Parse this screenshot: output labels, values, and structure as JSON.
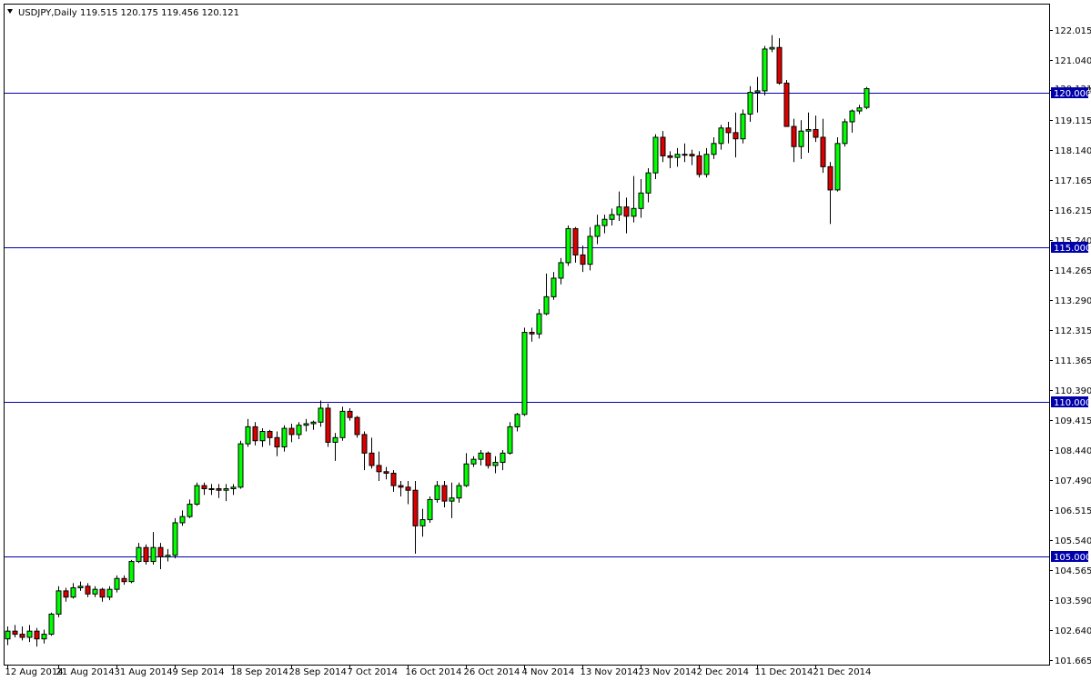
{
  "header": {
    "symbol": "USDJPY,Daily",
    "ohlc": "119.515 120.175 119.456 120.121"
  },
  "colors": {
    "background": "#ffffff",
    "frame": "#000000",
    "bull": "#00ff00",
    "bear": "#dd0000",
    "wick": "#000000",
    "level_line": "#0000aa",
    "level_label_bg": "#0000aa",
    "level_label_text": "#ffffff"
  },
  "chart_data": {
    "type": "candlestick",
    "title": "USDJPY,Daily",
    "ylim": [
      101.665,
      122.015
    ],
    "price_ticks": [
      "122.015",
      "121.040",
      "120.090",
      "119.115",
      "118.140",
      "117.165",
      "116.215",
      "115.240",
      "114.265",
      "113.290",
      "112.315",
      "111.365",
      "110.390",
      "109.415",
      "108.440",
      "107.490",
      "106.515",
      "105.540",
      "104.565",
      "103.590",
      "102.640",
      "101.665"
    ],
    "date_ticks": [
      "12 Aug 2014",
      "21 Aug 2014",
      "31 Aug 2014",
      "9 Sep 2014",
      "18 Sep 2014",
      "28 Sep 2014",
      "7 Oct 2014",
      "16 Oct 2014",
      "26 Oct 2014",
      "4 Nov 2014",
      "13 Nov 2014",
      "23 Nov 2014",
      "2 Dec 2014",
      "11 Dec 2014",
      "21 Dec 2014"
    ],
    "date_tick_bar_index": [
      0,
      7,
      15,
      23,
      31,
      39,
      47,
      55,
      63,
      71,
      79,
      87,
      95,
      103,
      111
    ],
    "levels": [
      {
        "value": 120.0,
        "label": "120.000"
      },
      {
        "value": 115.0,
        "label": "115.000"
      },
      {
        "value": 110.0,
        "label": "110.000"
      },
      {
        "value": 105.0,
        "label": "105.000"
      }
    ],
    "current_price": {
      "value": 120.121,
      "label": "120.121"
    },
    "grid": false,
    "candles": [
      [
        102.35,
        102.75,
        102.15,
        102.6
      ],
      [
        102.6,
        102.8,
        102.4,
        102.5
      ],
      [
        102.5,
        102.75,
        102.3,
        102.4
      ],
      [
        102.4,
        102.8,
        102.25,
        102.6
      ],
      [
        102.6,
        102.7,
        102.1,
        102.35
      ],
      [
        102.35,
        102.65,
        102.2,
        102.5
      ],
      [
        102.5,
        103.2,
        102.45,
        103.15
      ],
      [
        103.15,
        104.05,
        103.05,
        103.9
      ],
      [
        103.9,
        104.0,
        103.55,
        103.7
      ],
      [
        103.7,
        104.15,
        103.65,
        104.0
      ],
      [
        104.0,
        104.2,
        103.9,
        104.05
      ],
      [
        104.05,
        104.15,
        103.7,
        103.8
      ],
      [
        103.8,
        104.05,
        103.7,
        103.95
      ],
      [
        103.95,
        104.0,
        103.55,
        103.7
      ],
      [
        103.7,
        104.05,
        103.6,
        103.95
      ],
      [
        103.95,
        104.4,
        103.85,
        104.3
      ],
      [
        104.3,
        104.4,
        104.1,
        104.2
      ],
      [
        104.2,
        104.9,
        104.15,
        104.85
      ],
      [
        104.85,
        105.45,
        104.8,
        105.3
      ],
      [
        105.3,
        105.4,
        104.75,
        104.85
      ],
      [
        104.85,
        105.8,
        104.75,
        105.3
      ],
      [
        105.3,
        105.45,
        104.6,
        105.0
      ],
      [
        105.0,
        105.25,
        104.85,
        105.05
      ],
      [
        105.05,
        106.25,
        104.95,
        106.1
      ],
      [
        106.1,
        106.5,
        106.0,
        106.3
      ],
      [
        106.3,
        106.85,
        106.25,
        106.7
      ],
      [
        106.7,
        107.4,
        106.65,
        107.3
      ],
      [
        107.3,
        107.4,
        107.0,
        107.2
      ],
      [
        107.2,
        107.35,
        107.0,
        107.2
      ],
      [
        107.2,
        107.35,
        106.9,
        107.15
      ],
      [
        107.15,
        107.35,
        106.8,
        107.2
      ],
      [
        107.2,
        107.35,
        107.0,
        107.25
      ],
      [
        107.25,
        108.75,
        107.2,
        108.65
      ],
      [
        108.65,
        109.45,
        108.55,
        109.2
      ],
      [
        109.2,
        109.35,
        108.6,
        108.75
      ],
      [
        108.75,
        109.15,
        108.55,
        109.05
      ],
      [
        109.05,
        109.1,
        108.6,
        108.85
      ],
      [
        108.85,
        109.05,
        108.25,
        108.55
      ],
      [
        108.55,
        109.25,
        108.4,
        109.15
      ],
      [
        109.15,
        109.3,
        108.7,
        108.95
      ],
      [
        108.95,
        109.35,
        108.8,
        109.25
      ],
      [
        109.25,
        109.45,
        109.05,
        109.3
      ],
      [
        109.3,
        109.4,
        109.1,
        109.35
      ],
      [
        109.35,
        110.05,
        109.2,
        109.8
      ],
      [
        109.8,
        109.95,
        108.55,
        108.7
      ],
      [
        108.7,
        109.0,
        108.1,
        108.85
      ],
      [
        108.85,
        109.85,
        108.75,
        109.7
      ],
      [
        109.7,
        109.8,
        109.4,
        109.5
      ],
      [
        109.5,
        109.55,
        108.85,
        108.95
      ],
      [
        108.95,
        109.05,
        107.8,
        108.35
      ],
      [
        108.35,
        108.85,
        107.85,
        107.95
      ],
      [
        107.95,
        108.4,
        107.45,
        107.75
      ],
      [
        107.75,
        107.9,
        107.5,
        107.7
      ],
      [
        107.7,
        107.8,
        107.1,
        107.3
      ],
      [
        107.3,
        107.45,
        106.95,
        107.25
      ],
      [
        107.25,
        107.45,
        106.7,
        107.15
      ],
      [
        107.15,
        107.45,
        105.1,
        106.0
      ],
      [
        106.0,
        106.55,
        105.65,
        106.2
      ],
      [
        106.2,
        106.95,
        106.1,
        106.85
      ],
      [
        106.85,
        107.45,
        106.75,
        107.3
      ],
      [
        107.3,
        107.45,
        106.6,
        106.8
      ],
      [
        106.8,
        107.4,
        106.25,
        106.9
      ],
      [
        106.9,
        107.4,
        106.75,
        107.3
      ],
      [
        107.3,
        108.35,
        107.25,
        108.0
      ],
      [
        108.0,
        108.25,
        107.9,
        108.15
      ],
      [
        108.15,
        108.45,
        107.95,
        108.35
      ],
      [
        108.35,
        108.4,
        107.85,
        107.95
      ],
      [
        107.95,
        108.25,
        107.7,
        108.05
      ],
      [
        108.05,
        108.45,
        107.8,
        108.35
      ],
      [
        108.35,
        109.35,
        108.3,
        109.2
      ],
      [
        109.2,
        109.65,
        109.05,
        109.6
      ],
      [
        109.6,
        112.4,
        109.55,
        112.25
      ],
      [
        112.25,
        112.4,
        111.95,
        112.2
      ],
      [
        112.2,
        113.0,
        112.05,
        112.85
      ],
      [
        112.85,
        114.15,
        112.8,
        113.4
      ],
      [
        113.4,
        114.2,
        113.3,
        114.0
      ],
      [
        114.0,
        114.65,
        113.8,
        114.5
      ],
      [
        114.5,
        115.7,
        114.4,
        115.6
      ],
      [
        115.6,
        115.65,
        114.5,
        114.75
      ],
      [
        114.75,
        115.05,
        114.2,
        114.45
      ],
      [
        114.45,
        115.65,
        114.25,
        115.35
      ],
      [
        115.35,
        116.05,
        115.1,
        115.7
      ],
      [
        115.7,
        116.05,
        115.45,
        115.9
      ],
      [
        115.9,
        116.25,
        115.7,
        116.05
      ],
      [
        116.05,
        116.8,
        115.85,
        116.3
      ],
      [
        116.3,
        116.6,
        115.45,
        116.0
      ],
      [
        116.0,
        117.3,
        115.8,
        116.25
      ],
      [
        116.25,
        117.2,
        115.95,
        116.75
      ],
      [
        116.75,
        117.55,
        116.45,
        117.4
      ],
      [
        117.4,
        118.65,
        117.2,
        118.55
      ],
      [
        118.55,
        118.75,
        117.75,
        117.95
      ],
      [
        117.95,
        118.1,
        117.55,
        117.9
      ],
      [
        117.9,
        118.2,
        117.6,
        118.0
      ],
      [
        118.0,
        118.35,
        117.75,
        118.0
      ],
      [
        118.0,
        118.15,
        117.65,
        117.95
      ],
      [
        117.95,
        118.1,
        117.25,
        117.35
      ],
      [
        117.35,
        118.2,
        117.25,
        118.0
      ],
      [
        118.0,
        118.55,
        117.85,
        118.35
      ],
      [
        118.35,
        118.95,
        118.15,
        118.85
      ],
      [
        118.85,
        119.05,
        118.35,
        118.7
      ],
      [
        118.7,
        119.35,
        117.9,
        118.5
      ],
      [
        118.5,
        119.45,
        118.35,
        119.3
      ],
      [
        119.3,
        120.2,
        119.05,
        120.0
      ],
      [
        120.0,
        120.5,
        119.35,
        120.05
      ],
      [
        120.05,
        121.5,
        119.9,
        121.4
      ],
      [
        121.4,
        121.85,
        121.3,
        121.45
      ],
      [
        121.45,
        121.75,
        120.25,
        120.3
      ],
      [
        120.3,
        120.4,
        118.9,
        118.9
      ],
      [
        118.9,
        119.15,
        117.75,
        118.25
      ],
      [
        118.25,
        119.1,
        117.85,
        118.75
      ],
      [
        118.75,
        119.35,
        118.05,
        118.8
      ],
      [
        118.8,
        119.25,
        118.4,
        118.55
      ],
      [
        118.55,
        119.15,
        117.4,
        117.6
      ],
      [
        117.6,
        117.75,
        115.75,
        116.85
      ],
      [
        116.85,
        118.55,
        116.8,
        118.35
      ],
      [
        118.35,
        119.15,
        118.25,
        119.05
      ],
      [
        119.05,
        119.45,
        118.7,
        119.4
      ],
      [
        119.4,
        119.6,
        119.3,
        119.5
      ],
      [
        119.515,
        120.175,
        119.456,
        120.121
      ]
    ]
  }
}
